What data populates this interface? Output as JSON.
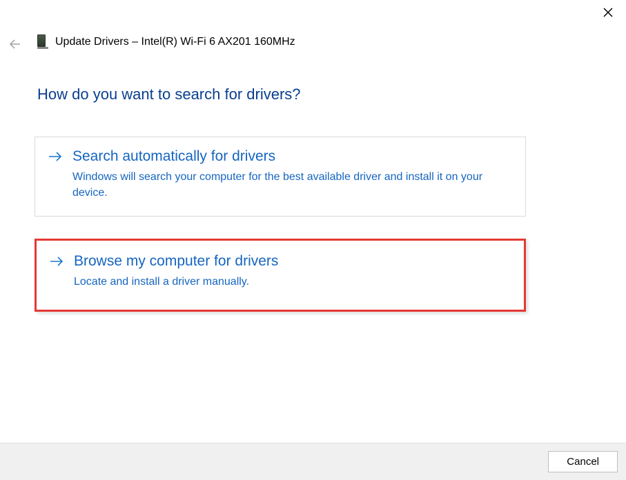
{
  "window": {
    "title": "Update Drivers – Intel(R) Wi-Fi 6 AX201 160MHz"
  },
  "page": {
    "heading": "How do you want to search for drivers?"
  },
  "options": [
    {
      "title": "Search automatically for drivers",
      "description": "Windows will search your computer for the best available driver and install it on your device.",
      "highlighted": false
    },
    {
      "title": "Browse my computer for drivers",
      "description": "Locate and install a driver manually.",
      "highlighted": true
    }
  ],
  "footer": {
    "cancel_label": "Cancel"
  }
}
